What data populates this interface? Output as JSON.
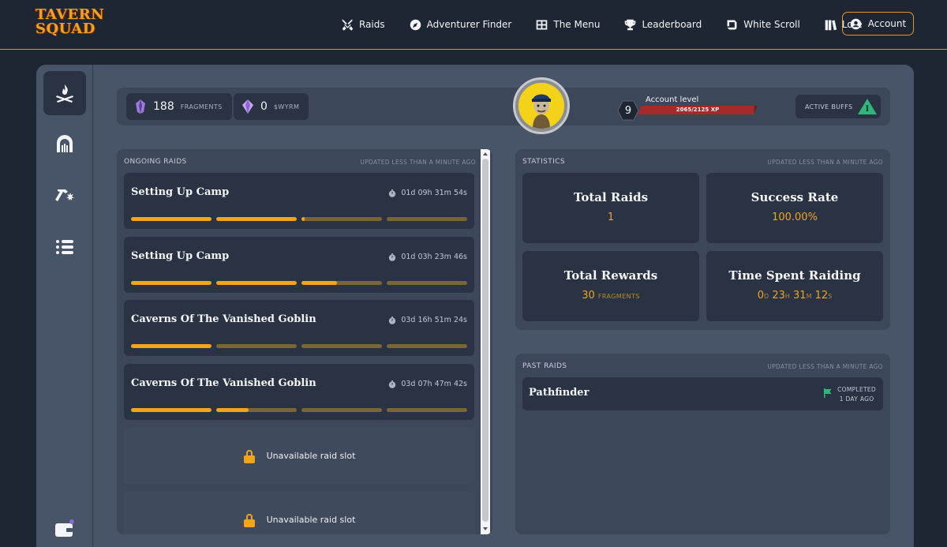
{
  "logo": {
    "line1": "TAVERN",
    "line2": "SQUAD"
  },
  "nav": [
    {
      "label": "Raids",
      "icon": "crossed-swords-icon"
    },
    {
      "label": "Adventurer Finder",
      "icon": "compass-icon"
    },
    {
      "label": "The Menu",
      "icon": "menu-grid-icon"
    },
    {
      "label": "Leaderboard",
      "icon": "trophy-icon"
    },
    {
      "label": "White Scroll",
      "icon": "scroll-icon"
    },
    {
      "label": "Lore",
      "icon": "books-icon"
    }
  ],
  "account": {
    "label": "Account"
  },
  "currencies": [
    {
      "amount": "188",
      "unit": "FRAGMENTS"
    },
    {
      "amount": "0",
      "unit": "$WYRM"
    }
  ],
  "level": {
    "number": "9",
    "title": "Account level",
    "xp": "2065/2125 XP",
    "progress": 0.97
  },
  "buffs": {
    "label": "ACTIVE BUFFS",
    "badge": "I"
  },
  "ongoing": {
    "heading": "ONGOING RAIDS",
    "updated": "UPDATED LESS THAN A MINUTE AGO",
    "raids": [
      {
        "name": "Setting Up Camp",
        "time": "01d 09h 31m 54s",
        "segments": [
          1,
          1,
          0.04,
          0
        ]
      },
      {
        "name": "Setting Up Camp",
        "time": "01d 03h 23m 46s",
        "segments": [
          1,
          1,
          0.44,
          0
        ]
      },
      {
        "name": "Caverns Of The Vanished Goblin",
        "time": "03d 16h 51m 24s",
        "segments": [
          1,
          0,
          0,
          0
        ]
      },
      {
        "name": "Caverns Of The Vanished Goblin",
        "time": "03d 07h 47m 42s",
        "segments": [
          1,
          0.4,
          0,
          0
        ]
      }
    ],
    "slots": [
      {
        "label": "Unavailable raid slot"
      },
      {
        "label": "Unavailable raid slot"
      }
    ]
  },
  "statistics": {
    "heading": "STATISTICS",
    "updated": "UPDATED LESS THAN A MINUTE AGO",
    "total_raids": {
      "title": "Total Raids",
      "value": "1"
    },
    "success_rate": {
      "title": "Success Rate",
      "value": "100.00%"
    },
    "total_rewards": {
      "title": "Total Rewards",
      "value": "30",
      "unit": "FRAGMENTS"
    },
    "time_spent": {
      "title": "Time Spent Raiding",
      "d": "0",
      "d_u": "D",
      "h": "23",
      "h_u": "H",
      "m": "31",
      "m_u": "M",
      "s": "12",
      "s_u": "S"
    }
  },
  "past": {
    "heading": "PAST RAIDS",
    "updated": "UPDATED LESS THAN A MINUTE AGO",
    "items": [
      {
        "name": "Pathfinder",
        "status": "COMPLETED",
        "when": "1 DAY AGO"
      }
    ]
  },
  "colors": {
    "accent": "#f2a518",
    "panel": "#3c475a",
    "card": "#2a3343",
    "xp": "#a52a2a"
  }
}
